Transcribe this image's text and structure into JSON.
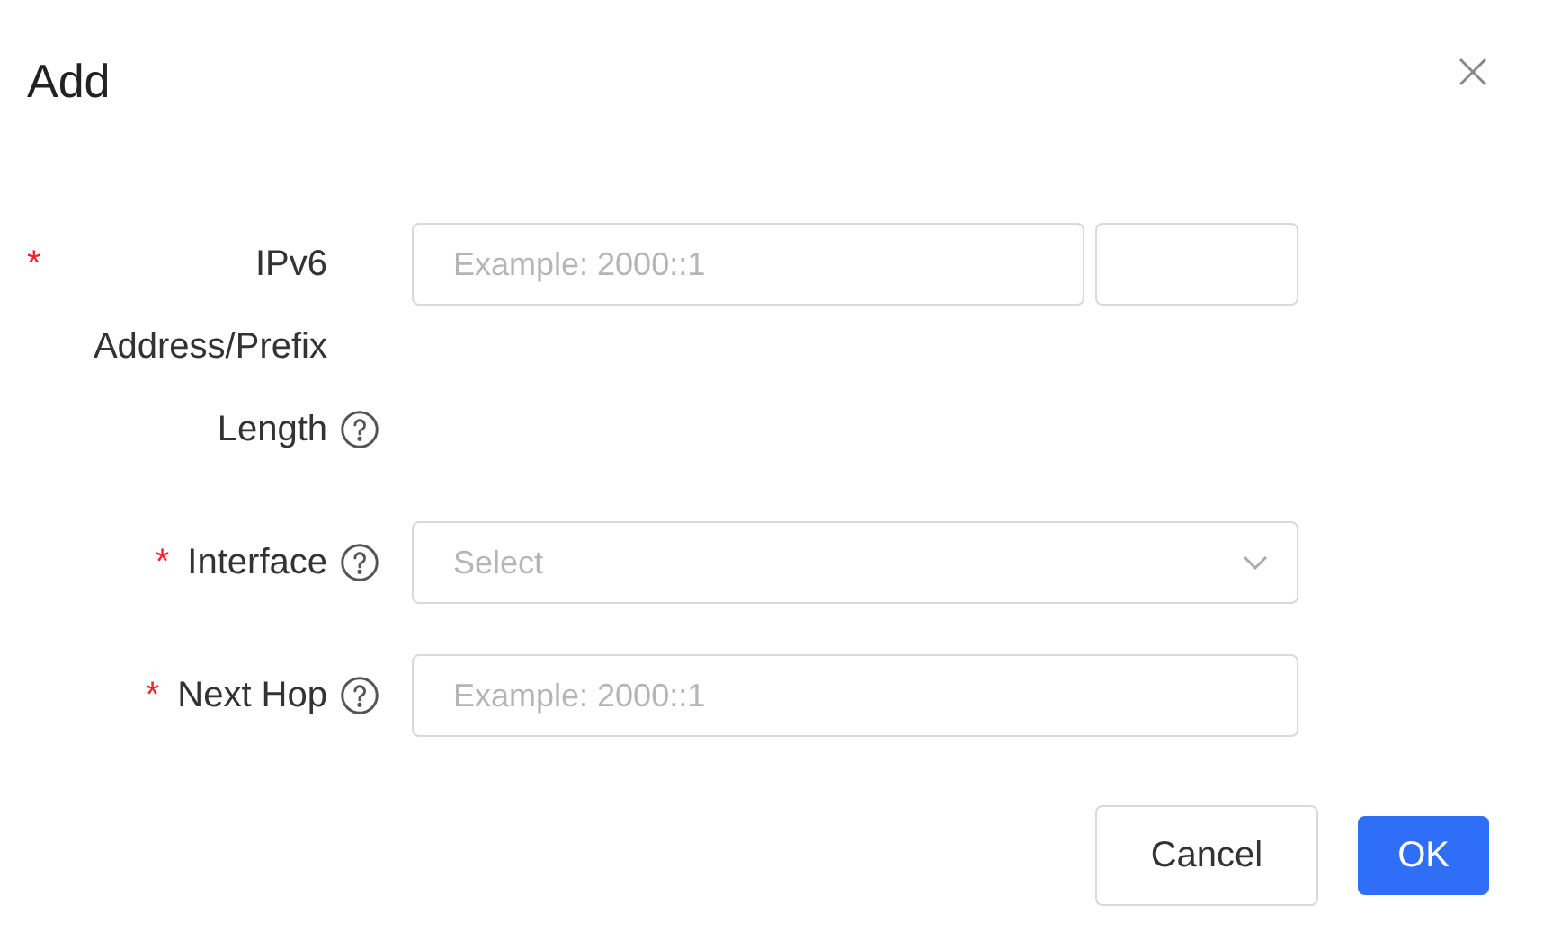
{
  "dialog": {
    "title": "Add"
  },
  "fields": [
    {
      "label": "IPv6 Address/Prefix Length",
      "required_mark": "*",
      "help": true,
      "kind": "address-prefix",
      "placeholder": "Example: 2000::1"
    },
    {
      "label": "Interface",
      "required_mark": "*",
      "help": true,
      "kind": "select",
      "placeholder": "Select"
    },
    {
      "label": "Next Hop",
      "required_mark": "*",
      "help": true,
      "kind": "text",
      "placeholder": "Example: 2000::1"
    }
  ],
  "buttons": [
    {
      "label": "Cancel",
      "kind": "secondary"
    },
    {
      "label": "OK",
      "kind": "primary"
    }
  ]
}
